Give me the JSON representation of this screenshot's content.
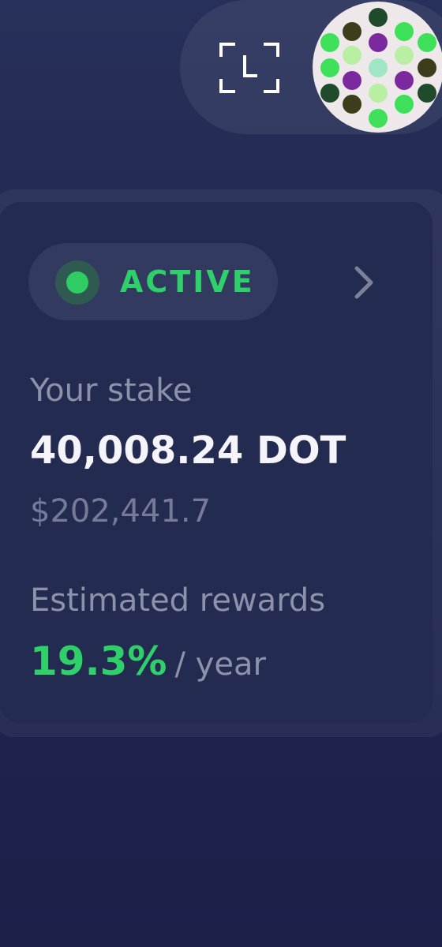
{
  "header": {
    "scan_icon": "scan-qr-icon",
    "avatar_icon": "identicon-avatar"
  },
  "stake_card": {
    "status": "ACTIVE",
    "status_color": "#2fd06a",
    "chevron_icon": "chevron-right-icon",
    "stake_label": "Your stake",
    "stake_amount": "40,008.24 DOT",
    "stake_fiat": "$202,441.7",
    "rewards_label": "Estimated rewards",
    "rewards_percent": "19.3%",
    "rewards_period": "/ year"
  }
}
